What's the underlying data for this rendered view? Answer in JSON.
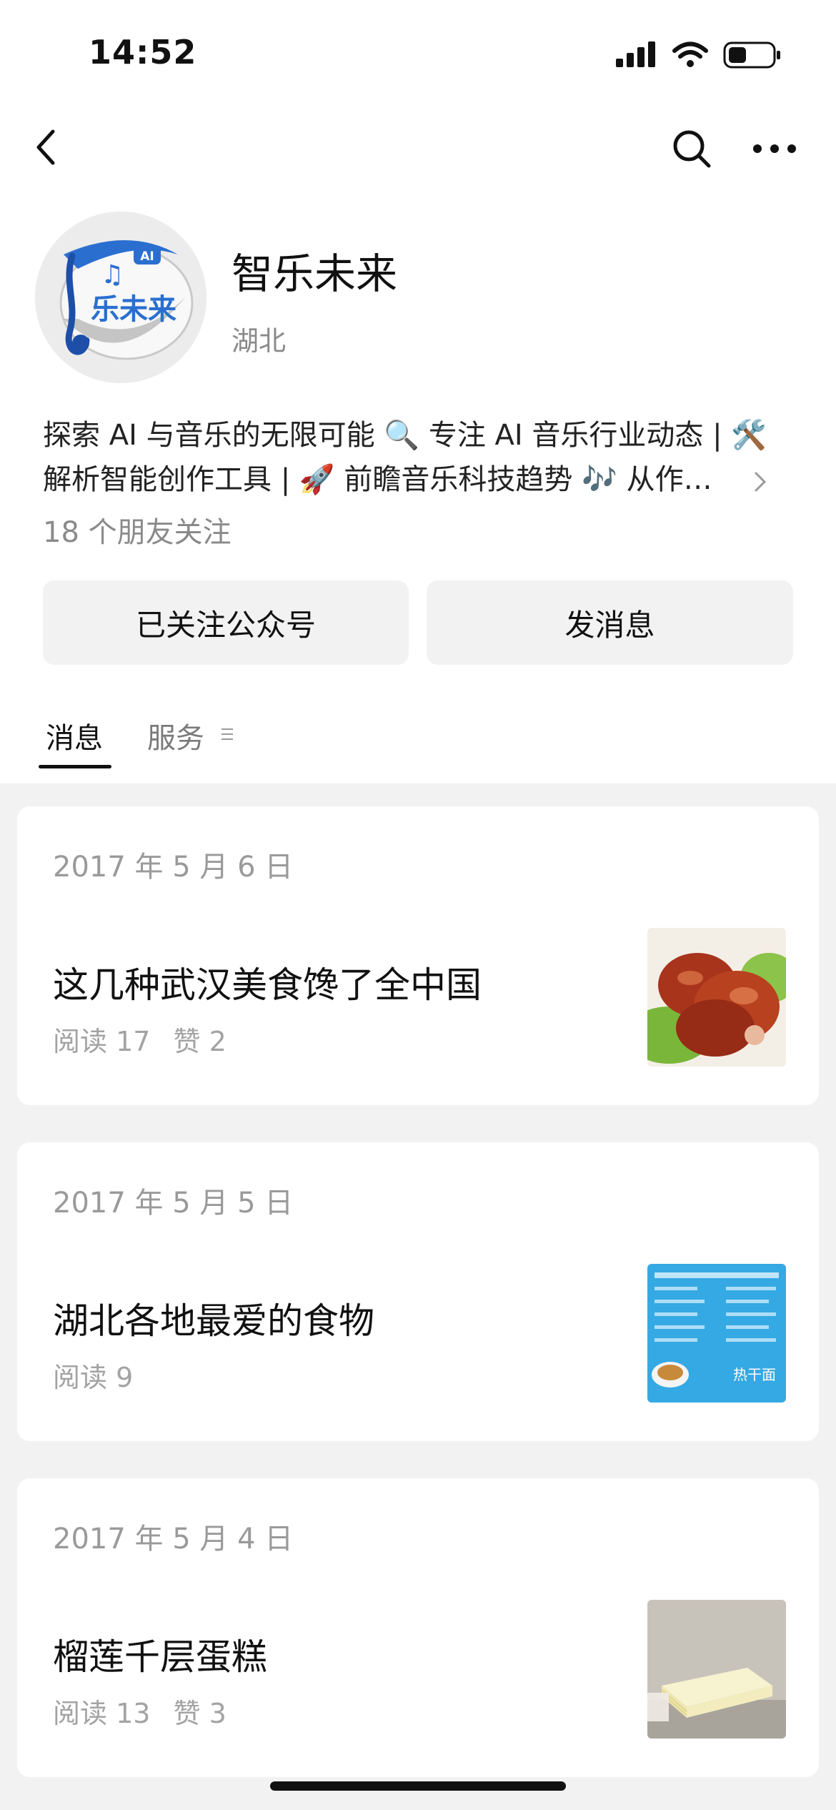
{
  "status_bar": {
    "time": "14:52"
  },
  "profile": {
    "name": "智乐未来",
    "region": "湖北",
    "avatar_text": "乐未来",
    "bio_lines": [
      "探索 AI 与音乐的无限可能 🔍 专注 AI 音乐行业动态 | 🛠️",
      "解析智能创作工具 | 🚀 前瞻音乐科技趋势 🎶 从作…"
    ],
    "friends_following": "18 个朋友关注"
  },
  "actions": {
    "followed_label": "已关注公众号",
    "message_label": "发消息"
  },
  "tabs": [
    {
      "label": "消息"
    },
    {
      "label": "服务"
    }
  ],
  "articles": [
    {
      "date": "2017 年 5 月 6 日",
      "title": "这几种武汉美食馋了全中国",
      "reads": "阅读 17",
      "likes": "赞 2"
    },
    {
      "date": "2017 年 5 月 5 日",
      "title": "湖北各地最爱的食物",
      "reads": "阅读 9",
      "likes": ""
    },
    {
      "date": "2017 年 5 月 4 日",
      "title": "榴莲千层蛋糕",
      "reads": "阅读 13",
      "likes": "赞 3"
    }
  ],
  "thumb2_caption": "热干面",
  "colors": {
    "feed_bg": "#f2f2f2",
    "button_bg": "#f2f2f2",
    "brand_blue": "#2a6fd0"
  },
  "icons": [
    "back-icon",
    "search-icon",
    "more-icon",
    "chevron-right-icon",
    "menu-lines-icon"
  ]
}
